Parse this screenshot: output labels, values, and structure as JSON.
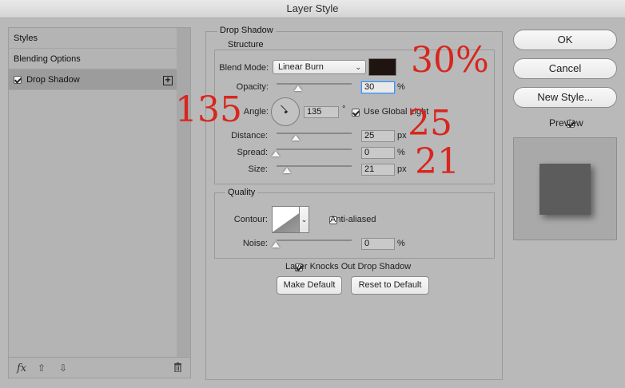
{
  "window": {
    "title": "Layer Style"
  },
  "sidebar": {
    "items": [
      {
        "label": "Styles"
      },
      {
        "label": "Blending Options"
      },
      {
        "label": "Drop Shadow",
        "checked": true
      }
    ],
    "add_icon": "plus-square-icon",
    "bottom_icons": [
      "fx-icon",
      "arrow-up-icon",
      "arrow-down-icon",
      "trash-icon"
    ],
    "fx_label": "fx"
  },
  "drop_shadow": {
    "section_title": "Drop Shadow",
    "structure": {
      "title": "Structure",
      "blend_mode_label": "Blend Mode:",
      "blend_mode_value": "Linear Burn",
      "shadow_color": "#1f140f",
      "opacity_label": "Opacity:",
      "opacity_value": "30",
      "opacity_fraction": 0.3,
      "opacity_unit": "%",
      "angle_label": "Angle:",
      "angle_value": "135",
      "angle_unit": "°",
      "use_global_light_label": "Use Global Light",
      "use_global_light": true,
      "distance_label": "Distance:",
      "distance_value": "25",
      "distance_unit": "px",
      "spread_label": "Spread:",
      "spread_value": "0",
      "spread_unit": "%",
      "size_label": "Size:",
      "size_value": "21",
      "size_unit": "px"
    },
    "quality": {
      "title": "Quality",
      "contour_label": "Contour:",
      "anti_aliased_label": "Anti-aliased",
      "anti_aliased": false,
      "noise_label": "Noise:",
      "noise_value": "0",
      "noise_unit": "%"
    },
    "knockout_label": "Layer Knocks Out Drop Shadow",
    "knockout_checked": true,
    "make_default_label": "Make Default",
    "reset_default_label": "Reset to Default"
  },
  "actions": {
    "ok_label": "OK",
    "cancel_label": "Cancel",
    "new_style_label": "New Style...",
    "preview_label": "Preview",
    "preview_checked": true
  },
  "annotations": {
    "opacity_note": "30%",
    "angle_note": "135",
    "distance_note": "25",
    "size_note": "21",
    "color": "#d8261e"
  }
}
